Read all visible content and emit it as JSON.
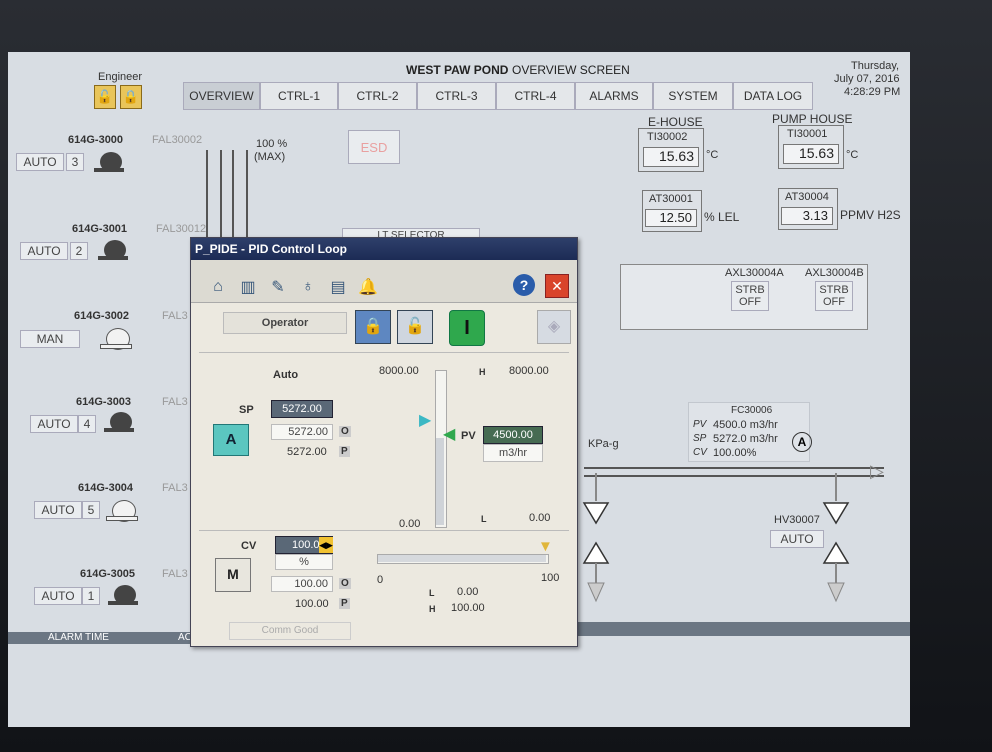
{
  "header": {
    "title": "WEST PAW POND",
    "subtitle": "OVERVIEW SCREEN",
    "user": "Engineer",
    "day": "Thursday,",
    "date": "July 07, 2016",
    "time": "4:28:29 PM"
  },
  "tabs": [
    "OVERVIEW",
    "CTRL-1",
    "CTRL-2",
    "CTRL-3",
    "CTRL-4",
    "ALARMS",
    "SYSTEM",
    "DATA LOG"
  ],
  "pumps": [
    {
      "id": "614G-3000",
      "fal": "FAL30002",
      "mode": "AUTO",
      "num": "3"
    },
    {
      "id": "614G-3001",
      "fal": "FAL30012",
      "mode": "AUTO",
      "num": "2"
    },
    {
      "id": "614G-3002",
      "fal": "FAL3",
      "mode": "MAN",
      "num": ""
    },
    {
      "id": "614G-3003",
      "fal": "FAL3",
      "mode": "AUTO",
      "num": "4"
    },
    {
      "id": "614G-3004",
      "fal": "FAL3",
      "mode": "AUTO",
      "num": "5"
    },
    {
      "id": "614G-3005",
      "fal": "FAL3",
      "mode": "AUTO",
      "num": "1"
    }
  ],
  "tank": {
    "pct": "100 %",
    "max": "(MAX)"
  },
  "esd": "ESD",
  "lt_selector": "LT SELECTOR",
  "ehouse": {
    "label": "E-HOUSE",
    "tag": "TI30002",
    "value": "15.63",
    "unit": "°C"
  },
  "pumphouse": {
    "label": "PUMP HOUSE",
    "tag": "TI30001",
    "value": "15.63",
    "unit": "°C"
  },
  "at1": {
    "tag": "AT30001",
    "value": "12.50",
    "unit": "% LEL"
  },
  "at2": {
    "tag": "AT30004",
    "value": "3.13",
    "unit": "PPMV H2S"
  },
  "axl": [
    {
      "tag": "AXL30004A",
      "s1": "STRB",
      "s2": "OFF"
    },
    {
      "tag": "AXL30004B",
      "s1": "STRB",
      "s2": "OFF"
    }
  ],
  "kpa": "KPa-g",
  "fc": {
    "tag": "FC30006",
    "pv_l": "PV",
    "pv": "4500.0 m3/hr",
    "sp_l": "SP",
    "sp": "5272.0 m3/hr",
    "cv_l": "CV",
    "cv": "100.00%",
    "mode": "A"
  },
  "hv": {
    "tag": "HV30007",
    "mode": "AUTO"
  },
  "alarm": {
    "time": "ALARM TIME",
    "ack": "AC"
  },
  "dialog": {
    "title": "P_PIDE - PID Control Loop",
    "help": "?",
    "close": "✕",
    "operator": "Operator",
    "mode_ind": "I",
    "auto": "Auto",
    "sp_label": "SP",
    "sp_value": "5272.00",
    "sp_o": "5272.00",
    "sp_p": "5272.00",
    "o": "O",
    "p": "P",
    "pv_label": "PV",
    "pv_value": "4500.00",
    "pv_unit": "m3/hr",
    "h_label": "H",
    "l_label": "L",
    "scale_max": "8000.00",
    "scale_max_r": "8000.00",
    "scale_min": "0.00",
    "scale_min_r": "0.00",
    "cv_label": "CV",
    "cv_value": "100.00",
    "cv_unit": "%",
    "cv_o": "100.00",
    "cv_p": "100.00",
    "bar_min": "0",
    "bar_max": "100",
    "cv_l": "0.00",
    "cv_h": "100.00",
    "auto_btn": "A",
    "man_btn": "M",
    "comm": "Comm Good"
  }
}
